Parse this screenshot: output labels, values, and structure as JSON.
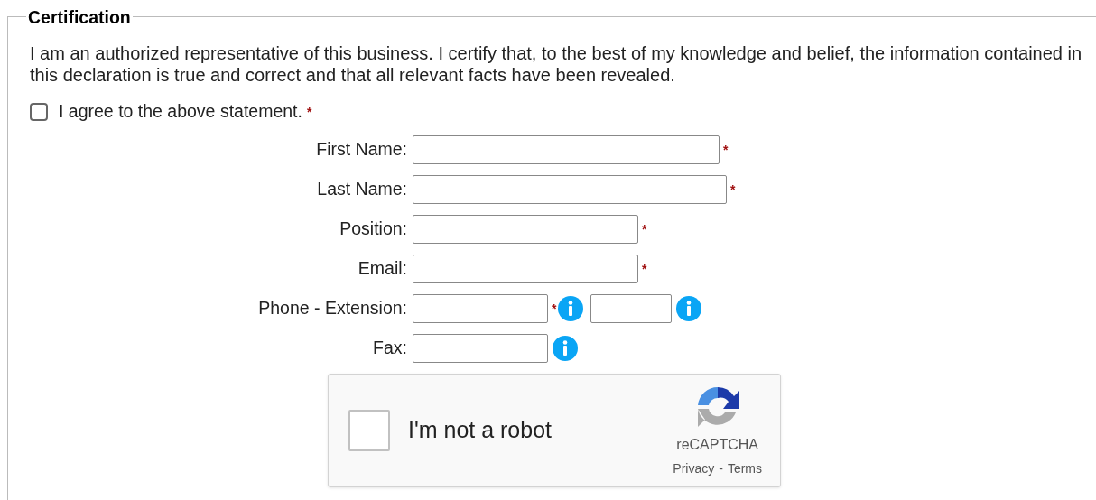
{
  "section": {
    "legend": "Certification",
    "statement": "I am an authorized representative of this business. I certify that, to the best of my knowledge and belief, the information contained in this declaration is true and correct and that all relevant facts have been revealed.",
    "agree": {
      "label": "I agree to the above statement.",
      "required_mark": "*",
      "checked": false
    },
    "rows": [
      {
        "label": "First Name:",
        "inputs": [
          {
            "required_mark": "*",
            "info": false
          }
        ]
      },
      {
        "label": "Last Name:",
        "inputs": [
          {
            "required_mark": "*",
            "info": false
          }
        ]
      },
      {
        "label": "Position:",
        "inputs": [
          {
            "required_mark": "*",
            "info": false
          }
        ]
      },
      {
        "label": "Email:",
        "inputs": [
          {
            "required_mark": "*",
            "info": false
          }
        ]
      },
      {
        "label": "Phone - Extension:",
        "inputs": [
          {
            "required_mark": "*",
            "info": true
          },
          {
            "info": true
          }
        ]
      },
      {
        "label": "Fax:",
        "inputs": [
          {
            "info": true
          }
        ]
      }
    ],
    "captcha": {
      "label": "I'm not a robot",
      "checked": false,
      "brand": "reCAPTCHA",
      "privacy": "Privacy",
      "separator": "-",
      "terms": "Terms"
    }
  }
}
